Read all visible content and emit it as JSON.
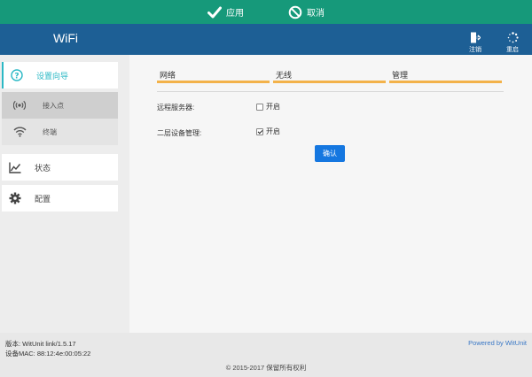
{
  "toolbar": {
    "apply_label": "应用",
    "cancel_label": "取消"
  },
  "header": {
    "brand": "WiFi",
    "logout_label": "注销",
    "reboot_label": "重启"
  },
  "sidebar": {
    "setup_wizard": "设置向导",
    "access_point": "接入点",
    "terminal": "终端",
    "status": "状态",
    "config": "配置",
    "accent_color": "#2bb8c5"
  },
  "tabs": [
    "网络",
    "无线",
    "管理"
  ],
  "form": {
    "remote_server_label": "远程服务器:",
    "remote_server_option": "开启",
    "remote_server_checked": false,
    "l2_mgmt_label": "二层设备管理:",
    "l2_mgmt_option": "开启",
    "l2_mgmt_checked": true,
    "confirm_label": "确认"
  },
  "footer": {
    "version": "版本: WitUnit link/1.5.17",
    "mac": "设备MAC: 88:12:4e:00:05:22",
    "powered": "Powered by WitUnit",
    "copyright": "© 2015-2017  保留所有权利"
  },
  "colors": {
    "topbar": "#16997a",
    "header": "#1d5f95",
    "tab_underline": "#f3b24a",
    "button": "#1577e0"
  }
}
